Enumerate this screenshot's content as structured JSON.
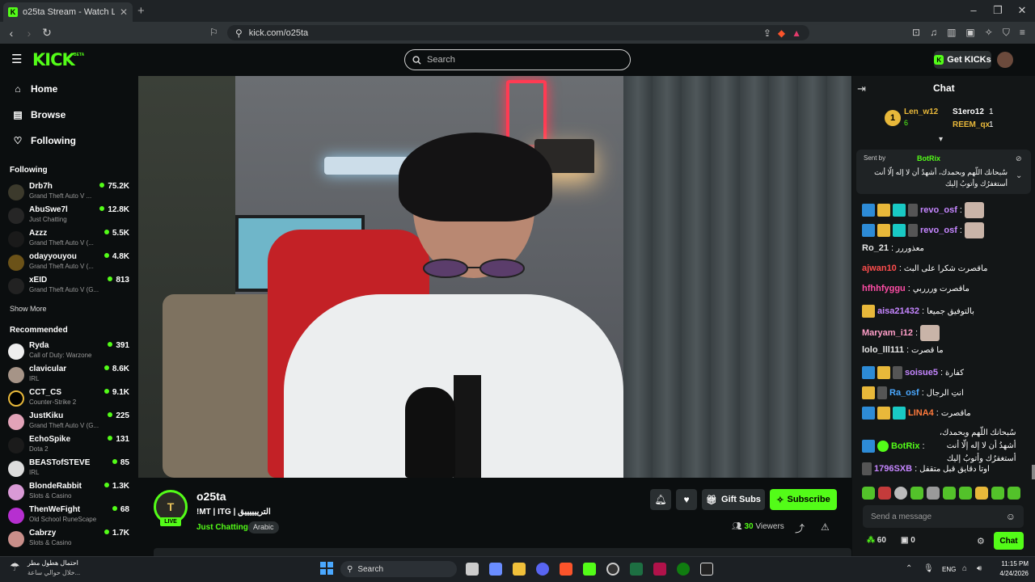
{
  "browser": {
    "tab_title": "o25ta Stream - Watch Live on Kick",
    "url": "kick.com/o25ta"
  },
  "header": {
    "logo": "KICK",
    "logo_badge": "BETA",
    "search_placeholder": "Search",
    "get_kicks": "Get KICKs"
  },
  "sidebar": {
    "nav": [
      {
        "label": "Home",
        "icon": "home-icon"
      },
      {
        "label": "Browse",
        "icon": "browse-icon"
      },
      {
        "label": "Following",
        "icon": "heart-icon"
      }
    ],
    "following_title": "Following",
    "following": [
      {
        "name": "Drb7h",
        "category": "Grand Theft Auto V ...",
        "viewers": "75.2K"
      },
      {
        "name": "AbuSwe7l",
        "category": "Just Chatting",
        "viewers": "12.8K"
      },
      {
        "name": "Azzz",
        "category": "Grand Theft Auto V (...",
        "viewers": "5.5K"
      },
      {
        "name": "odayyouyou",
        "category": "Grand Theft Auto V (...",
        "viewers": "4.8K"
      },
      {
        "name": "xEID",
        "category": "Grand Theft Auto V (G...",
        "viewers": "813"
      }
    ],
    "show_more": "Show More",
    "recommended_title": "Recommended",
    "recommended": [
      {
        "name": "Ryda",
        "category": "Call of Duty: Warzone",
        "viewers": "391"
      },
      {
        "name": "clavicular",
        "category": "IRL",
        "viewers": "8.6K"
      },
      {
        "name": "CCT_CS",
        "category": "Counter-Strike 2",
        "viewers": "9.1K"
      },
      {
        "name": "JustKiku",
        "category": "Grand Theft Auto V (G...",
        "viewers": "225"
      },
      {
        "name": "EchoSpike",
        "category": "Dota 2",
        "viewers": "131"
      },
      {
        "name": "BEASTofSTEVE",
        "category": "IRL",
        "viewers": "85"
      },
      {
        "name": "BlondeRabbit",
        "category": "Slots & Casino",
        "viewers": "1.3K"
      },
      {
        "name": "ThenWeFight",
        "category": "Old School RuneScape",
        "viewers": "68"
      },
      {
        "name": "Cabrzy",
        "category": "Slots & Casino",
        "viewers": "1.7K"
      }
    ]
  },
  "stream": {
    "streamer": "o25ta",
    "live_label": "LIVE",
    "title": "!MT | ITG | الترييييييق",
    "category": "Just Chatting",
    "tag": "Arabic",
    "gift_subs": "Gift Subs",
    "subscribe": "Subscribe",
    "viewers": "30",
    "viewers_label": "Viewers"
  },
  "chat": {
    "title": "Chat",
    "leaderboard": [
      {
        "rank": "1",
        "name": "Len_w12",
        "value": "6"
      },
      {
        "name": "S1ero12",
        "value": "1"
      },
      {
        "name": "REEM_qx",
        "value": "1"
      }
    ],
    "pinned": {
      "sent_by": "Sent by",
      "name": "BotRix",
      "text": "سُبحانك اللّهم وبحمدك، أشهدُ أن لا إله إلّا أنت أستغفرُك وأتوبُ إليك"
    },
    "messages": [
      {
        "user": "revo_osf",
        "color": "#c586ff",
        "text": "",
        "badges": [
          "blue",
          "gold",
          "cyan",
          "grey"
        ],
        "emote": true
      },
      {
        "user": "revo_osf",
        "color": "#c586ff",
        "text": "",
        "badges": [
          "blue",
          "gold",
          "cyan",
          "grey"
        ],
        "emote": true
      },
      {
        "user": "Ro_21",
        "color": "#e6e6e6",
        "text": "معذوررر",
        "badges": []
      },
      {
        "user": "ajwan10",
        "color": "#ff4d4d",
        "text": "ماقصرت شكرا على البث",
        "badges": []
      },
      {
        "user": "hfhhfyggu",
        "color": "#ff4da6",
        "text": "ماقصرت وررربي",
        "badges": []
      },
      {
        "user": "aisa21432",
        "color": "#c586ff",
        "text": "بالتوفيق جميعا",
        "badges": [
          "gold"
        ]
      },
      {
        "user": "Maryam_i12",
        "color": "#ff9ec8",
        "text": "",
        "badges": [],
        "emote": true
      },
      {
        "user": "lolo_lll111",
        "color": "#e6e6e6",
        "text": "ما قصرت",
        "badges": []
      },
      {
        "user": "soisue5",
        "color": "#c586ff",
        "text": "كفارة",
        "badges": [
          "blue",
          "gold",
          "grey"
        ]
      },
      {
        "user": "Ra_osf",
        "color": "#4aa8ff",
        "text": "انتِ الرجال",
        "badges": [
          "gold",
          "grey"
        ]
      },
      {
        "user": "LINA4",
        "color": "#ff7a3c",
        "text": "ماقصرت",
        "badges": [
          "blue",
          "gold",
          "cyan"
        ]
      },
      {
        "user": "BotRix",
        "color": "#53fc18",
        "text": "سُبحانك اللّهم وبحمدك، أشهدُ أن لا إله إلّا أنت أستغفرُك وأتوبُ إليك",
        "badges": [
          "blue",
          "verified"
        ]
      },
      {
        "user": "1796SXB",
        "color": "#c586ff",
        "text": "اوتا دقايق قبل متقفل",
        "badges": [
          "grey"
        ]
      }
    ],
    "input_placeholder": "Send a message",
    "points": "60",
    "claim": "0",
    "send": "Chat"
  },
  "taskbar": {
    "weather_line1": "احتمال هطول مطر",
    "weather_line2": "خلال حوالي ساعة...",
    "search": "Search",
    "lang": "ENG",
    "time": "11:15 PM",
    "date": "4/24/2026"
  },
  "colors": {
    "accent": "#53fc18",
    "background": "#0b0e0f",
    "chat_bg": "#131617"
  }
}
